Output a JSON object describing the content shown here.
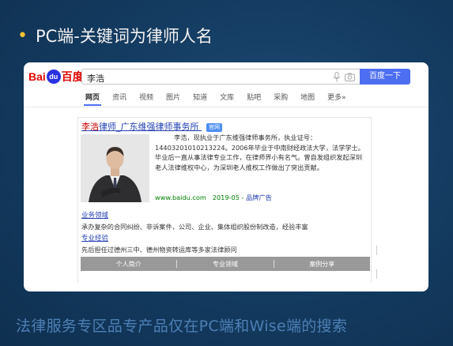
{
  "slide": {
    "title": "PC端-关键词为律师人名",
    "footer": "法律服务专区品专产品仅在PC端和Wise端的搜索"
  },
  "baidu": {
    "logo": {
      "bai": "Bai",
      "du": "du",
      "cn": "百度"
    },
    "search": {
      "query": "李浩",
      "button_label": "百度一下"
    },
    "tabs": [
      "网页",
      "资讯",
      "视频",
      "图片",
      "知道",
      "文库",
      "贴吧",
      "采购",
      "地图",
      "更多»"
    ],
    "active_tab": 0,
    "result": {
      "title_highlight": "李浩",
      "title_rest": "律师_广东维强律师事务所",
      "badge": "官网",
      "description": "李浩，现执业于广东维强律师事务所，执业证号：14403201010213224。2006年毕业于中南财经政法大学，法学学士。毕业后一直从事法律专业工作，在律师界小有名气。曾自发组织发起深圳老人法律维权中心，为深圳老人维权工作做出了突出贡献。",
      "url": "www.baidu.com",
      "date": "2019-05",
      "ad_label": "品牌广告",
      "section1_link": "业务领域",
      "section1_text": "承办复杂的合同纠纷、非诉案件，公司、企业、集体组织股份制改造，经验丰富",
      "section2_link": "专业经验",
      "section2_text": "先后担任过德州三中、德州物资转运库等多家法律顾问",
      "tabbar": [
        "个人简介",
        "专业领域",
        "案例分享"
      ]
    }
  },
  "colors": {
    "accent": "#4e6ef2",
    "link": "#2440b3",
    "highlight": "#c00000",
    "url_green": "#008000",
    "background": "#133a5f"
  }
}
